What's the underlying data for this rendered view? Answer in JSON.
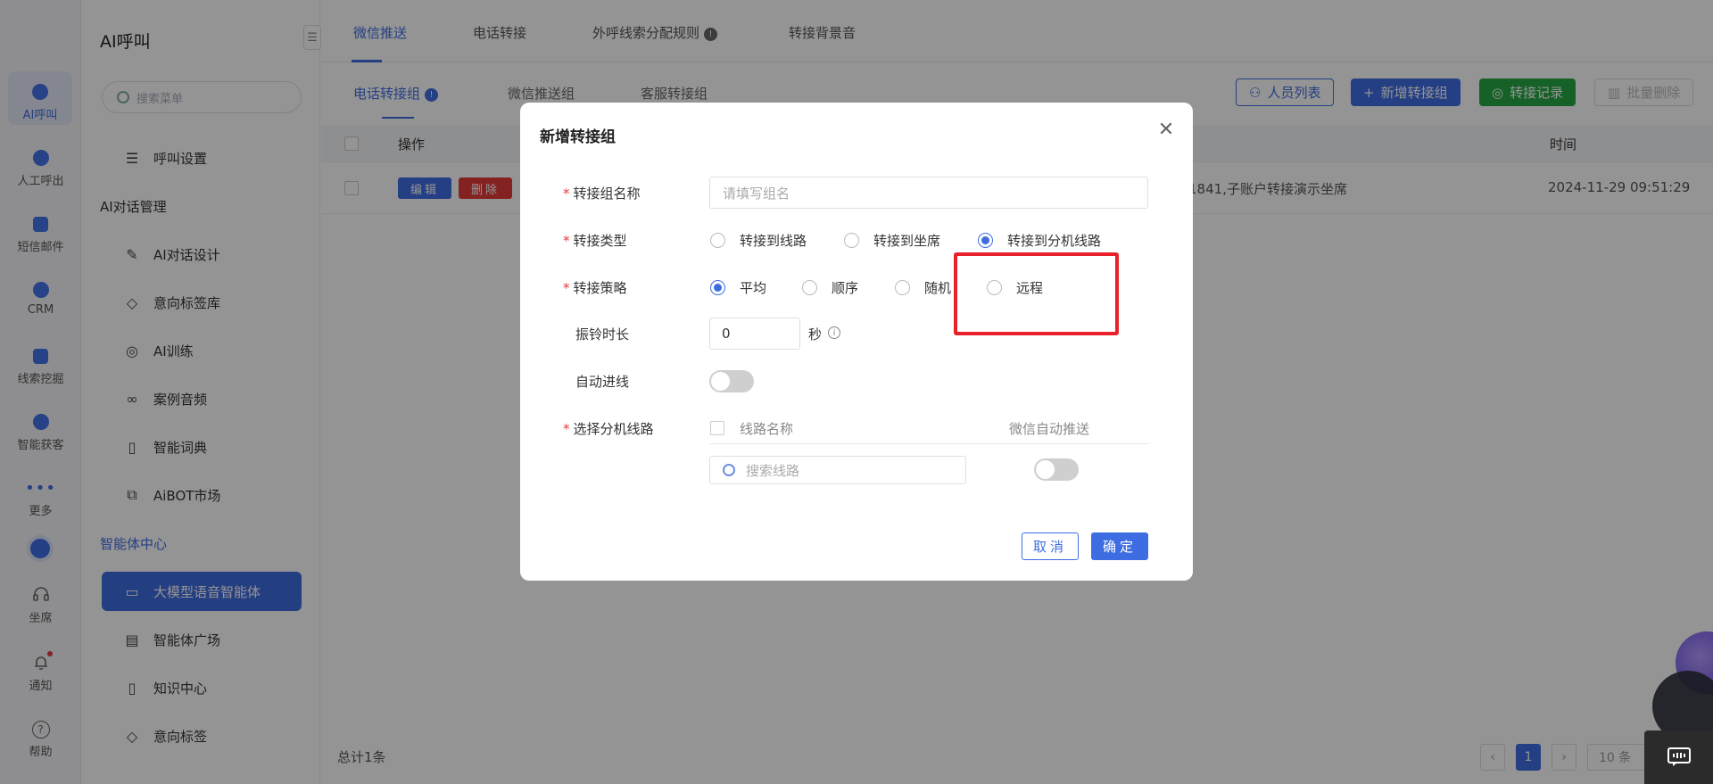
{
  "rail": {
    "items": [
      {
        "label": "AI呼叫",
        "icon": "robot-icon"
      },
      {
        "label": "人工呼出",
        "icon": "phone-icon"
      },
      {
        "label": "短信邮件",
        "icon": "message-icon"
      },
      {
        "label": "CRM",
        "icon": "crm-icon"
      },
      {
        "label": "线索挖掘",
        "icon": "lead-icon"
      },
      {
        "label": "智能获客",
        "icon": "target-icon"
      },
      {
        "label": "更多",
        "icon": "more-icon"
      },
      {
        "label": "坐席",
        "icon": "headset-icon"
      },
      {
        "label": "通知",
        "icon": "bell-icon"
      },
      {
        "label": "帮助",
        "icon": "help-icon"
      }
    ]
  },
  "sidebar": {
    "title": "AI呼叫",
    "search_placeholder": "搜索菜单",
    "items": [
      {
        "label": "呼叫设置",
        "icon": "sliders-icon"
      },
      {
        "label": "AI对话设计",
        "icon": "pen-icon"
      },
      {
        "label": "意向标签库",
        "icon": "tag-icon"
      },
      {
        "label": "AI训练",
        "icon": "chat-bubble-icon"
      },
      {
        "label": "案例音频",
        "icon": "voicemail-icon"
      },
      {
        "label": "智能词典",
        "icon": "book-icon"
      },
      {
        "label": "AiBOT市场",
        "icon": "market-icon"
      },
      {
        "label": "大模型语音智能体",
        "icon": "agent-icon"
      },
      {
        "label": "智能体广场",
        "icon": "store-icon"
      },
      {
        "label": "知识中心",
        "icon": "open-book-icon"
      },
      {
        "label": "意向标签",
        "icon": "tag-icon"
      }
    ],
    "sections": {
      "dialog_mgmt": "AI对话管理",
      "agent_center": "智能体中心"
    }
  },
  "main": {
    "top_tabs": [
      "微信推送",
      "电话转接",
      "外呼线索分配规则",
      "转接背景音"
    ],
    "sub_tabs": [
      "电话转接组",
      "微信推送组",
      "客服转接组"
    ],
    "toolbar": {
      "people_list": "人员列表",
      "add_group": "新增转接组",
      "transfer_record": "转接记录",
      "batch_delete": "批量删除"
    },
    "table": {
      "headers": {
        "action": "操作",
        "time": "时间"
      },
      "rows": [
        {
          "edit": "编辑",
          "delete": "删除",
          "desc": "1841,子账户转接演示坐席",
          "time": "2024-11-29 09:51:29"
        }
      ]
    },
    "total": "总计1条",
    "pager": {
      "current": "1",
      "page_size": "10 条"
    }
  },
  "dialog": {
    "title": "新增转接组",
    "fields": {
      "group_name": {
        "label": "转接组名称",
        "placeholder": "请填写组名"
      },
      "transfer_type": {
        "label": "转接类型",
        "options": [
          "转接到线路",
          "转接到坐席",
          "转接到分机线路"
        ],
        "selected": "转接到分机线路"
      },
      "strategy": {
        "label": "转接策略",
        "options": [
          "平均",
          "顺序",
          "随机",
          "远程"
        ],
        "selected": "平均"
      },
      "ring_time": {
        "label": "振铃时长",
        "value": "0",
        "unit": "秒"
      },
      "auto_join": {
        "label": "自动进线",
        "on": false
      },
      "line_select": {
        "label": "选择分机线路",
        "col_name": "线路名称",
        "col_wechat": "微信自动推送",
        "search_placeholder": "搜索线路"
      }
    },
    "cancel": "取消",
    "ok": "确定"
  },
  "colors": {
    "primary": "#3e6de3",
    "danger": "#e43c3c",
    "success": "#27a844",
    "highlight": "#e8202a"
  }
}
